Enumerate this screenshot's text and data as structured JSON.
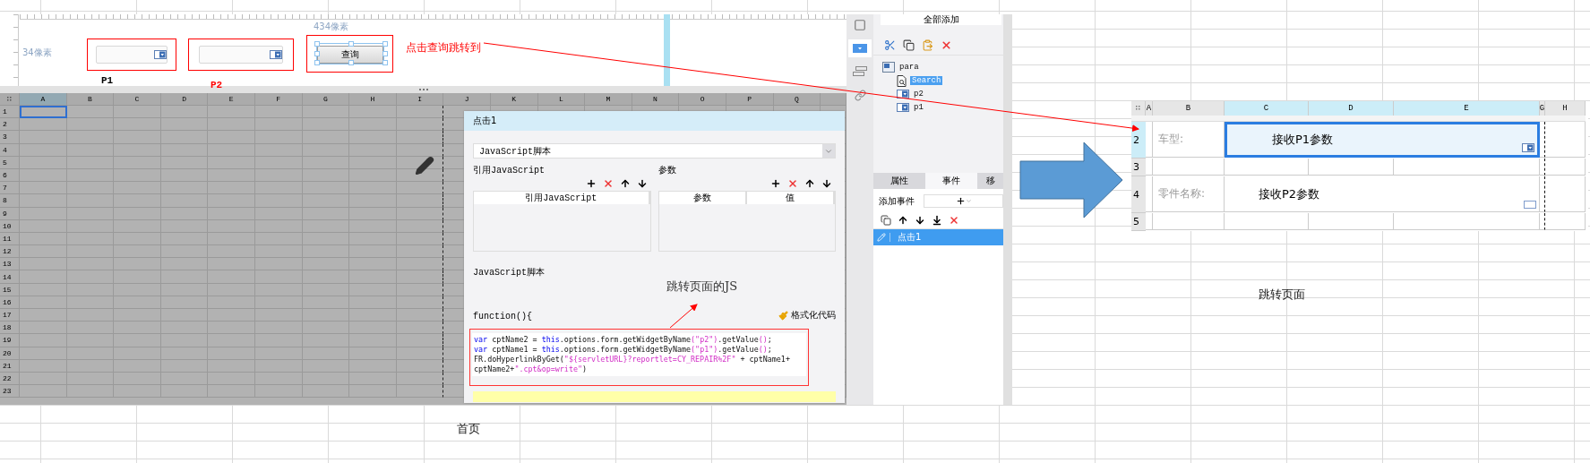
{
  "home_shot": {
    "ruler": {
      "top_label": "434像素",
      "left_label": "34像素"
    },
    "params": [
      {
        "label": "P1",
        "color": "#000000"
      },
      {
        "label": "P2",
        "color": "#ff0000"
      }
    ],
    "query_button": "查询",
    "click_note": "点击查询跳转到",
    "sheet": {
      "columns": [
        {
          "label": "A",
          "selected": true
        },
        {
          "label": "B",
          "selected": false
        },
        {
          "label": "C",
          "selected": false
        },
        {
          "label": "D",
          "selected": false
        },
        {
          "label": "E",
          "selected": false
        },
        {
          "label": "F",
          "selected": false
        },
        {
          "label": "G",
          "selected": false
        },
        {
          "label": "H",
          "selected": false
        },
        {
          "label": "I",
          "selected": false
        },
        {
          "label": "J",
          "selected": false
        },
        {
          "label": "K",
          "selected": false
        },
        {
          "label": "L",
          "selected": false
        },
        {
          "label": "M",
          "selected": false
        },
        {
          "label": "N",
          "selected": false
        },
        {
          "label": "O",
          "selected": false
        },
        {
          "label": "P",
          "selected": false
        },
        {
          "label": "Q",
          "selected": false
        }
      ],
      "rows": [
        "1",
        "2",
        "3",
        "4",
        "5",
        "6",
        "7",
        "8",
        "9",
        "10",
        "11",
        "12",
        "13",
        "14",
        "15",
        "16",
        "17",
        "18",
        "19",
        "20",
        "21",
        "22",
        "23"
      ]
    },
    "dialog": {
      "title": "点击1",
      "type_select": "JavaScript脚本",
      "ref_group": {
        "title": "引用JavaScript",
        "columns": [
          "引用JavaScript"
        ]
      },
      "param_group": {
        "title": "参数",
        "columns": [
          "参数",
          "值"
        ]
      },
      "script_group": {
        "title": "JavaScript脚本",
        "signature": "function(){",
        "format_button": "格式化代码",
        "note": "跳转页面的JS",
        "code_lines": [
          [
            {
              "kind": "keyword",
              "text": "var"
            },
            {
              "kind": "plain",
              "text": " cptName2 = "
            },
            {
              "kind": "keyword",
              "text": "this"
            },
            {
              "kind": "plain",
              "text": ".options.form.getWidgetByName"
            },
            {
              "kind": "string",
              "text": "(\"p2\")"
            },
            {
              "kind": "plain",
              "text": ".getValue"
            },
            {
              "kind": "string",
              "text": "()"
            },
            {
              "kind": "plain",
              "text": ";"
            }
          ],
          [
            {
              "kind": "keyword",
              "text": "var"
            },
            {
              "kind": "plain",
              "text": " cptName1 = "
            },
            {
              "kind": "keyword",
              "text": "this"
            },
            {
              "kind": "plain",
              "text": ".options.form.getWidgetByName"
            },
            {
              "kind": "string",
              "text": "(\"p1\")"
            },
            {
              "kind": "plain",
              "text": ".getValue"
            },
            {
              "kind": "string",
              "text": "()"
            },
            {
              "kind": "plain",
              "text": ";"
            }
          ],
          [
            {
              "kind": "plain",
              "text": "FR.doHyperlinkByGet("
            },
            {
              "kind": "string",
              "text": "\"${servletURL}?reportlet=CY_REPAIR%2F\""
            },
            {
              "kind": "plain",
              "text": " + cptName1+"
            }
          ],
          [
            {
              "kind": "plain",
              "text": "cptName2+"
            },
            {
              "kind": "string",
              "text": "\".cpt&op=write\""
            },
            {
              "kind": "plain",
              "text": ")"
            }
          ]
        ]
      }
    },
    "side_tools": [
      {
        "kind": "frame",
        "selected": false
      },
      {
        "kind": "combo",
        "selected": true
      },
      {
        "kind": "form",
        "selected": false
      },
      {
        "kind": "link",
        "selected": false
      }
    ],
    "widget_panel": {
      "add_all": "全部添加",
      "tree": {
        "label": "para",
        "children": [
          {
            "label": "Search",
            "kind": "button",
            "selected": true
          },
          {
            "label": "p2",
            "kind": "combo",
            "selected": false
          },
          {
            "label": "p1",
            "kind": "combo",
            "selected": false
          }
        ]
      },
      "tabs": [
        {
          "label": "属性",
          "selected": false
        },
        {
          "label": "事件",
          "selected": true
        },
        {
          "label": "移",
          "selected": false
        }
      ],
      "add_event_label": "添加事件",
      "events": [
        {
          "label": "点击1",
          "selected": true
        }
      ]
    }
  },
  "home_caption": "首页",
  "jump_shot": {
    "columns": [
      {
        "label": "A",
        "selected": false
      },
      {
        "label": "B",
        "selected": false
      },
      {
        "label": "C",
        "selected": true
      },
      {
        "label": "D",
        "selected": true
      },
      {
        "label": "E",
        "selected": true
      },
      {
        "label": "G",
        "selected": false
      },
      {
        "label": "H",
        "selected": false
      }
    ],
    "rows": [
      {
        "header": "2",
        "selected": true,
        "label": "车型:",
        "value": "接收P1参数",
        "kind": "combo"
      },
      {
        "header": "3",
        "selected": false
      },
      {
        "header": "4",
        "selected": false,
        "label": "零件名称:",
        "value": "接收P2参数",
        "kind": "text"
      },
      {
        "header": "5",
        "selected": false
      }
    ]
  },
  "jump_caption": "跳转页面"
}
